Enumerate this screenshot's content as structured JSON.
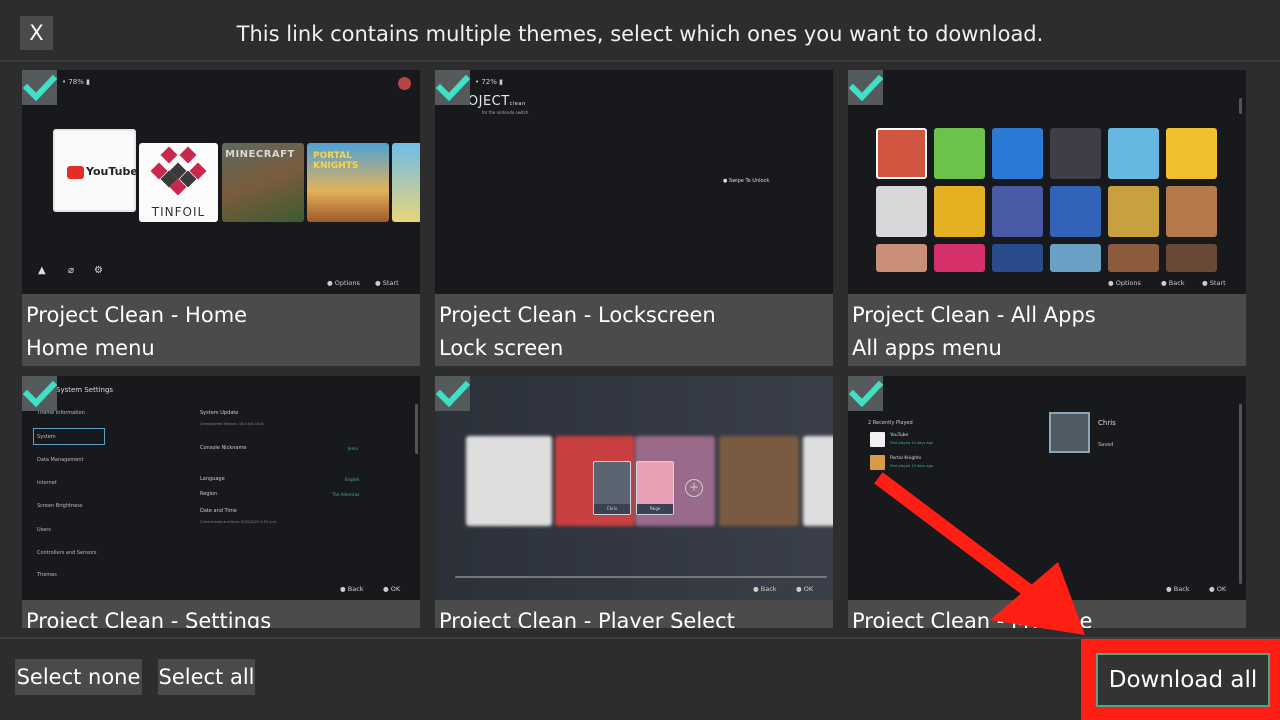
{
  "header": {
    "close_label": "X",
    "message": "This link contains multiple themes, select which ones you want to download."
  },
  "themes": [
    {
      "name": "Project Clean - Home",
      "description": "Home menu",
      "selected": true
    },
    {
      "name": "Project Clean - Lockscreen",
      "description": "Lock screen",
      "selected": true
    },
    {
      "name": "Project Clean - All Apps",
      "description": "All apps menu",
      "selected": true
    },
    {
      "name": "Project Clean - Settings",
      "description": "",
      "selected": true
    },
    {
      "name": "Project Clean - Player Select",
      "description": "",
      "selected": true
    },
    {
      "name": "Project Clean - MyPage",
      "description": "",
      "selected": true
    }
  ],
  "previews": {
    "home": {
      "youtube": "YouTube",
      "tinfoil": "TINFOIL",
      "minecraft": "MINECRAFT",
      "portal_knights": "PORTAL KNIGHTS",
      "status": "• 78% ▮",
      "options": "Options",
      "start": "Start"
    },
    "lockscreen": {
      "project": "PROJECT",
      "project_suffix": "clean",
      "subtitle": "for the nintendo switch",
      "status": "• 72% ▮",
      "swipe": "Swipe To Unlock"
    },
    "allapps": {
      "options": "Options",
      "back": "Back",
      "start": "Start"
    },
    "settings": {
      "title": "System Settings",
      "left_items": [
        "Theme Information",
        "System",
        "Data Management",
        "Internet",
        "Screen Brightness",
        "Users",
        "Controllers and Sensors",
        "Themes"
      ],
      "right": {
        "update": "System Update",
        "update_sub": "Unregistered Version: 10.0.0(8.18.0)",
        "nickname": "Console Nickname",
        "nickname_val": "Jenni",
        "language": "Language",
        "language_val": "English",
        "region": "Region",
        "region_val": "The Americas",
        "datetime": "Date and Time",
        "datetime_sub": "Current date and time: 8/20/2020 2:53 p.m."
      },
      "back": "Back",
      "ok": "OK"
    },
    "player_select": {
      "player1": "Chris",
      "player2": "Paige",
      "back": "Back",
      "ok": "OK"
    },
    "mypage": {
      "recently_played": "2 Recently Played",
      "app1": "YouTube",
      "app1_sub": "First played 10 days ago",
      "app2": "Portal Knights",
      "app2_sub": "First played 10 days ago",
      "name": "Chris",
      "saved": "Saved",
      "back": "Back",
      "ok": "OK"
    }
  },
  "footer": {
    "select_none": "Select none",
    "select_all": "Select all",
    "download_all": "Download all"
  },
  "colors": {
    "background": "#2d2d2d",
    "checkmark": "#3fe0c5",
    "highlight": "#ff1f14",
    "download_border": "#4ea58b"
  }
}
